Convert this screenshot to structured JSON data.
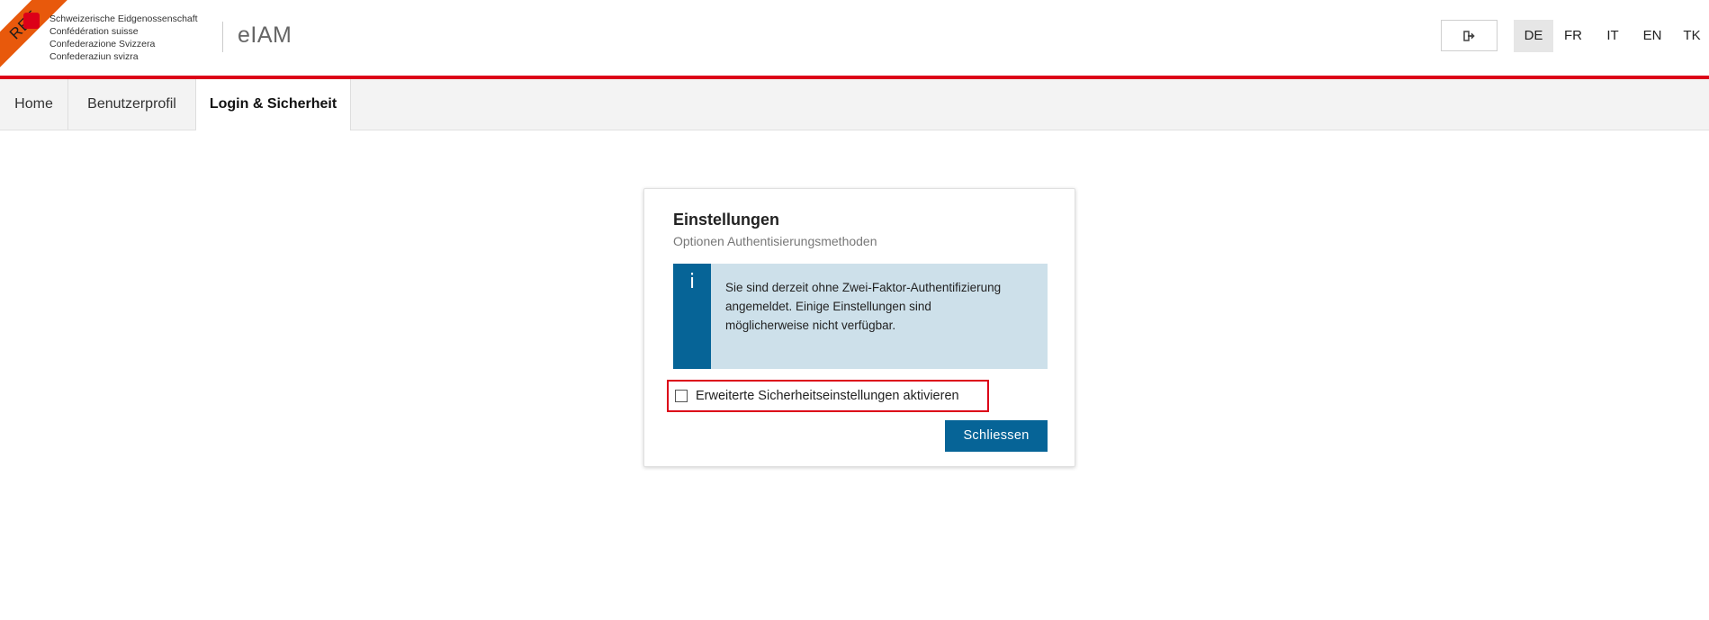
{
  "header": {
    "ribbon_label": "REF",
    "coat_lines": [
      "Schweizerische Eidgenossenschaft",
      "Confédération suisse",
      "Confederazione Svizzera",
      "Confederaziun svizra"
    ],
    "brand": "eIAM",
    "logout_icon": "sign-out-icon",
    "languages": [
      "DE",
      "FR",
      "IT",
      "EN",
      "TK"
    ],
    "active_language": "DE"
  },
  "nav": {
    "tabs": [
      {
        "label": "Home"
      },
      {
        "label": "Benutzerprofil"
      },
      {
        "label": "Login & Sicherheit"
      }
    ],
    "active_tab": "Login & Sicherheit"
  },
  "card": {
    "title": "Einstellungen",
    "subtitle": "Optionen Authentisierungsmethoden",
    "info_icon": "i",
    "info_text": "Sie sind derzeit ohne Zwei-Faktor-Authentifizierung angemeldet. Einige Einstellungen sind möglicherweise nicht verfügbar.",
    "checkbox_label": "Erweiterte Sicherheitseinstellungen aktivieren",
    "checkbox_checked": false,
    "close_button": "Schliessen"
  },
  "colors": {
    "accent_red": "#dc0018",
    "primary_blue": "#066497",
    "info_background": "#cde0ea",
    "ribbon_orange": "#e8590c"
  }
}
